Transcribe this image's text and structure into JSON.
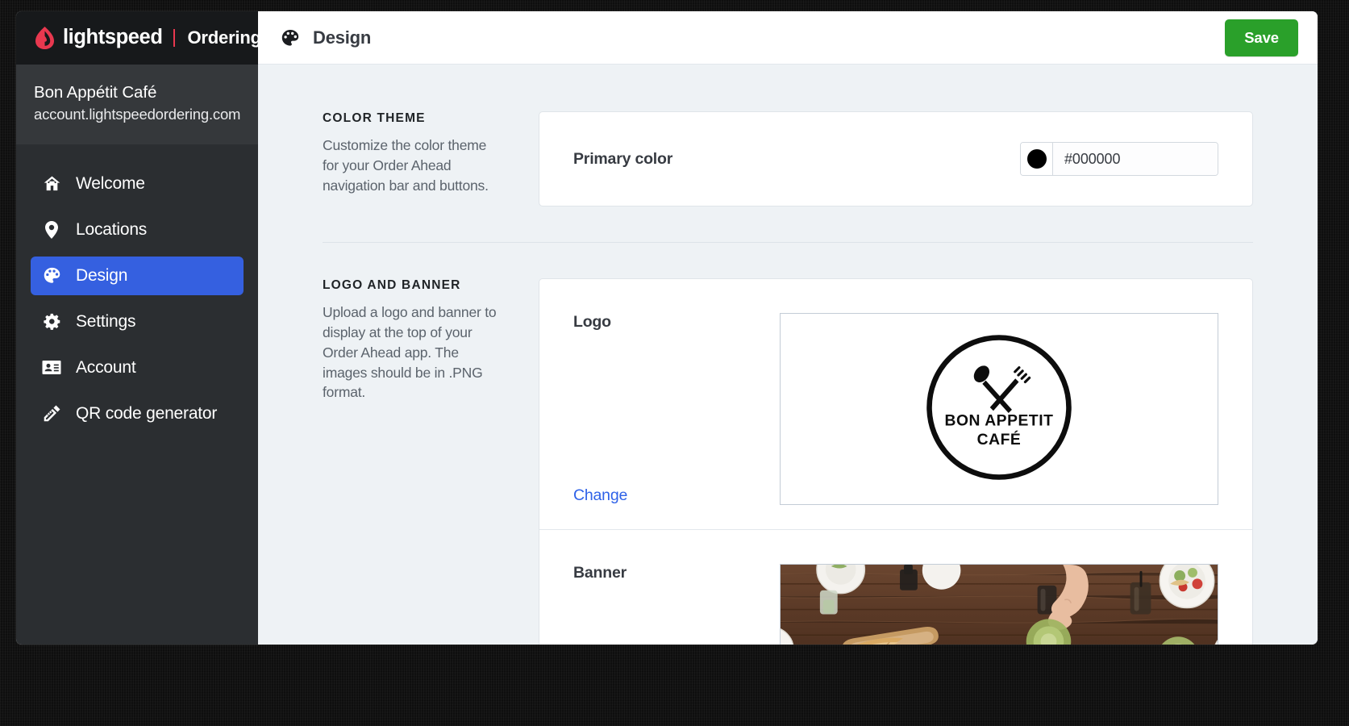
{
  "brand": {
    "name": "lightspeed",
    "product": "Ordering",
    "flame_color": "#e8384f"
  },
  "account": {
    "business_name": "Bon Appétit Café",
    "domain": "account.lightspeedordering.com"
  },
  "sidebar": {
    "items": [
      {
        "label": "Welcome",
        "icon": "home-icon",
        "active": false
      },
      {
        "label": "Locations",
        "icon": "map-pin-icon",
        "active": false
      },
      {
        "label": "Design",
        "icon": "palette-icon",
        "active": true
      },
      {
        "label": "Settings",
        "icon": "gear-icon",
        "active": false
      },
      {
        "label": "Account",
        "icon": "id-card-icon",
        "active": false
      },
      {
        "label": "QR code generator",
        "icon": "pencil-ruler-icon",
        "active": false
      }
    ],
    "active_color": "#3560e0"
  },
  "topbar": {
    "icon": "palette-icon",
    "title": "Design",
    "save_label": "Save",
    "save_color": "#2aa02a"
  },
  "sections": {
    "color_theme": {
      "kicker": "COLOR THEME",
      "description": "Customize the color theme for your Order Ahead navigation bar and buttons.",
      "primary_color_label": "Primary color",
      "primary_color_value": "#000000",
      "primary_color_placeholder": "#000000"
    },
    "logo_and_banner": {
      "kicker": "LOGO AND BANNER",
      "description": "Upload a logo and banner to display at the top of your Order Ahead app. The images should be in .PNG format.",
      "logo_label": "Logo",
      "logo_change_label": "Change",
      "logo_image": {
        "alt": "circular restaurant logo with crossed spoon and fork",
        "line1": "BON APPETIT",
        "line2": "CAFÉ"
      },
      "banner_label": "Banner",
      "banner_image": {
        "alt": "overhead photo of a wooden dining table with plates, bread, drinks and a hand reaching for a bowl"
      }
    }
  }
}
